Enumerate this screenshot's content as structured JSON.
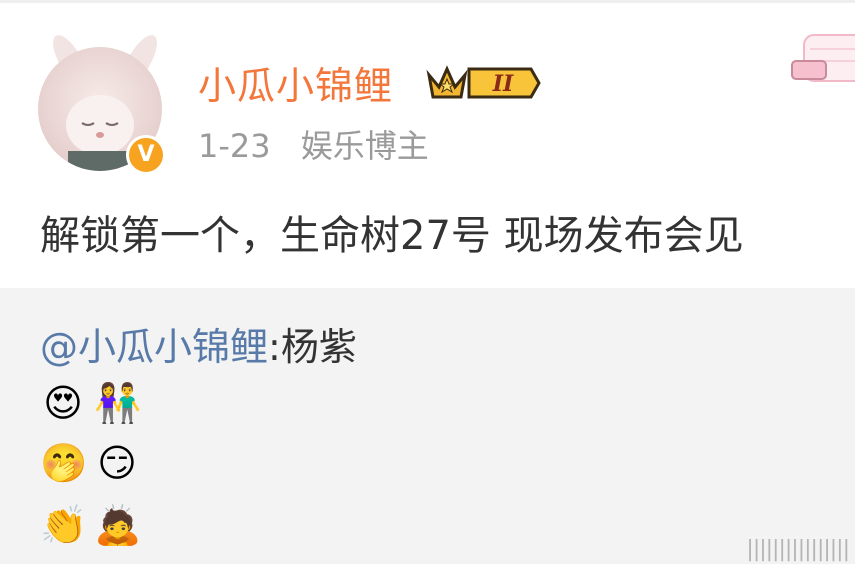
{
  "post": {
    "username": "小瓜小锦鲤",
    "level_badge": "II",
    "date": "1-23",
    "tag": "娱乐博主",
    "content": "解锁第一个，生命树27号 现场发布会见",
    "verified_mark": "V"
  },
  "repost": {
    "mention": "@小瓜小锦鲤",
    "text": ":杨紫",
    "emoji_rows": [
      [
        "😍",
        "👫"
      ],
      [
        "🤭",
        "😏"
      ],
      [
        "👏",
        "🙇"
      ]
    ]
  },
  "watermark": "||||||||||||||||"
}
